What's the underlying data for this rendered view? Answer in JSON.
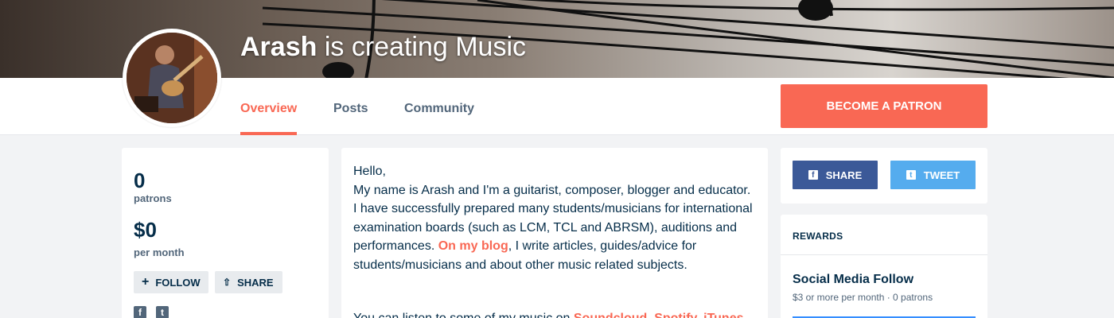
{
  "banner": {
    "creator_name": "Arash",
    "title_rest": " is creating Music"
  },
  "nav": {
    "tabs": [
      {
        "label": "Overview",
        "active": true
      },
      {
        "label": "Posts",
        "active": false
      },
      {
        "label": "Community",
        "active": false
      }
    ],
    "become_patron": "BECOME A PATRON"
  },
  "stats": {
    "patrons_value": "0",
    "patrons_label": "patrons",
    "monthly_value": "$0",
    "monthly_label": "per month",
    "follow_label": "FOLLOW",
    "share_label": "SHARE"
  },
  "about": {
    "intro": "Hello,\nMy name is Arash and I'm a guitarist, composer, blogger and educator. I have successfully prepared many students/musicians for international examination boards (such as LCM, TCL and ABRSM), auditions and performances. ",
    "blog_link": "On my blog",
    "after_link": ", I write articles, guides/advice for students/musicians and about other music related subjects.",
    "next_line": "You can listen to some of my music on ",
    "next_link": "Soundcloud, Spotify, iTunes"
  },
  "share": {
    "facebook_label": "SHARE",
    "twitter_label": "TWEET"
  },
  "rewards": {
    "heading": "REWARDS",
    "tiers": [
      {
        "title": "Social Media Follow",
        "meta": "$3 or more per month · 0 patrons"
      }
    ]
  },
  "colors": {
    "accent": "#f96854",
    "text": "#052d49",
    "muted": "#52667a",
    "facebook": "#3b5998",
    "twitter": "#55acee"
  }
}
